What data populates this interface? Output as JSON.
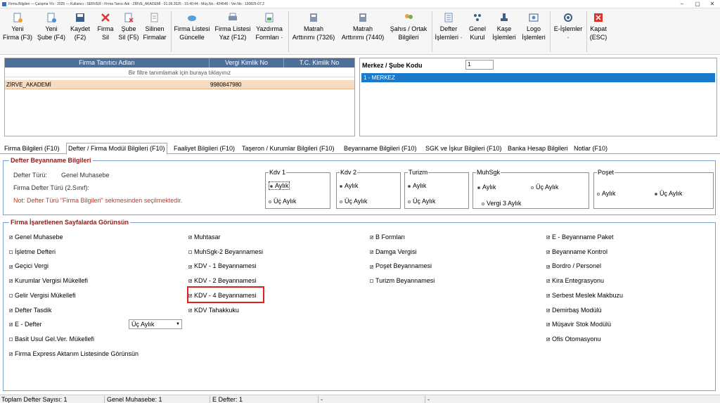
{
  "titlebar": {
    "text": "Firma Bilgileri — Çalışma Yılı : 2025 — Kullanıcı : SERVER - Firma Tanıcı Adı : ZİRVE_AKADEMİ - 01.09.2025 - 15:40:44 - Müş.No : 424646 - Ver.No : 130825-07.2"
  },
  "toolbar": [
    {
      "l1": "Yeni",
      "l2": "Firma (F3)",
      "icon": "new-company-icon"
    },
    {
      "l1": "Yeni",
      "l2": "Şube (F4)",
      "icon": "new-branch-icon"
    },
    {
      "l1": "Kaydet",
      "l2": "(F2)",
      "icon": "save-icon"
    },
    {
      "l1": "Firma",
      "l2": "Sil",
      "icon": "delete-icon"
    },
    {
      "l1": "Şube",
      "l2": "Sil (F5)",
      "icon": "delete-branch-icon"
    },
    {
      "l1": "Silinen",
      "l2": "Firmalar",
      "icon": "deleted-companies-icon"
    },
    {
      "l1": "Firma Listesi",
      "l2": "Güncelle",
      "icon": "refresh-list-icon"
    },
    {
      "l1": "Firma Listesi",
      "l2": "Yaz (F12)",
      "icon": "print-list-icon"
    },
    {
      "l1": "Yazdırma",
      "l2": "Formları ·",
      "icon": "print-forms-icon"
    },
    {
      "l1": "Matrah",
      "l2": "Arttırımı (7326)",
      "icon": "tax-base-icon"
    },
    {
      "l1": "Matrah",
      "l2": "Arttırımı (7440)",
      "icon": "tax-base-icon-2"
    },
    {
      "l1": "Şahıs / Ortak",
      "l2": "Bilgileri",
      "icon": "partners-icon"
    },
    {
      "l1": "Defter",
      "l2": "İşlemleri ·",
      "icon": "ledger-icon"
    },
    {
      "l1": "Genel",
      "l2": "Kurul",
      "icon": "general-assembly-icon"
    },
    {
      "l1": "Kaşe",
      "l2": "İşlemleri",
      "icon": "stamp-icon"
    },
    {
      "l1": "Logo",
      "l2": "İşlemleri",
      "icon": "logo-icon"
    },
    {
      "l1": "E-İşlemler",
      "l2": "·",
      "icon": "e-operations-icon"
    },
    {
      "l1": "Kapat",
      "l2": "(ESC)",
      "icon": "close-icon"
    }
  ],
  "grid": {
    "headers": [
      "Firma Tanıtıcı Adları",
      "Vergi Kimlik No",
      "T.C. Kimlik No"
    ],
    "filter": "Bir filtre tanımlamak için buraya tıklayınız",
    "rows": [
      {
        "name": "ZİRVE_AKADEMİ",
        "vkn": "9980847980",
        "tckn": ""
      }
    ]
  },
  "merkez": {
    "label": "Merkez / Şube Kodu",
    "value": "1",
    "selected": "1 - MERKEZ"
  },
  "tabs": [
    "Firma Bilgileri (F10)",
    "Defter / Firma Modül Bilgileri (F10)",
    "Faaliyet Bilgileri (F10)",
    "Taşeron / Kurumlar Bilgileri (F10)",
    "Beyanname Bilgileri (F10)",
    "SGK ve İşkur Bilgileri (F10)",
    "Banka Hesap Bilgileri",
    "Notlar (F10)"
  ],
  "defter": {
    "title": "Defter Beyanname Bilgileri",
    "turu_label": "Defter Türü:",
    "turu_value": "Genel Muhasebe",
    "firma_turu_label": "Firma Defter Türü (2.Sınıf):",
    "note": "Not: Defter Türü \"Firma Bilgileri\" sekmesinden seçilmektedir.",
    "groups": {
      "kdv1": {
        "title": "Kdv 1",
        "opt1": "Aylık",
        "opt2": "Üç Aylık"
      },
      "kdv2": {
        "title": "Kdv 2",
        "opt1": "Aylık",
        "opt2": "Üç Aylık"
      },
      "turizm": {
        "title": "Turizm",
        "opt1": "Aylık",
        "opt2": "Üç Aylık"
      },
      "muhsgk": {
        "title": "MuhSgk",
        "opt1": "Aylık",
        "opt2": "Üç Aylık",
        "opt3": "Vergi 3 Aylık"
      },
      "poset": {
        "title": "Poşet",
        "opt1": "Aylık",
        "opt2": "Üç Aylık"
      }
    }
  },
  "firma": {
    "title": "Firma İşaretlenen Sayfalarda Görünsün",
    "col1": [
      {
        "label": "Genel Muhasebe",
        "checked": true
      },
      {
        "label": "İşletme Defteri",
        "checked": false
      },
      {
        "label": "Geçici Vergi",
        "checked": true
      },
      {
        "label": "Kurumlar Vergisi Mükellefi",
        "checked": true
      },
      {
        "label": "Gelir Vergisi Mükellefi",
        "checked": false
      },
      {
        "label": "Defter Tasdik",
        "checked": true
      },
      {
        "label": "E - Defter",
        "checked": true
      },
      {
        "label": "Basit Usul Gel.Ver. Mükellefi",
        "checked": false
      },
      {
        "label": "Firma Express Aktarım Listesinde Görünsün",
        "checked": true
      }
    ],
    "edefter_select": "Üç Aylık",
    "col2": [
      {
        "label": "Muhtasar",
        "checked": true
      },
      {
        "label": "MuhSgk-2 Beyannamesi",
        "checked": false
      },
      {
        "label": "KDV - 1 Beyannamesi",
        "checked": true
      },
      {
        "label": "KDV - 2 Beyannamesi",
        "checked": true
      },
      {
        "label": "KDV - 4 Beyannamesi",
        "checked": true
      },
      {
        "label": "KDV Tahakkuku",
        "checked": true
      }
    ],
    "col3": [
      {
        "label": "B Formları",
        "checked": true
      },
      {
        "label": "Damga Vergisi",
        "checked": true
      },
      {
        "label": "Poşet Beyannamesi",
        "checked": true
      },
      {
        "label": "Turizm Beyannamesi",
        "checked": false
      }
    ],
    "col4": [
      {
        "label": "E - Beyanname Paket",
        "checked": true
      },
      {
        "label": "Beyanname Kontrol",
        "checked": true
      },
      {
        "label": "Bordro / Personel",
        "checked": true
      },
      {
        "label": "Kira Entegrasyonu",
        "checked": true
      },
      {
        "label": "Serbest Meslek Makbuzu",
        "checked": true
      },
      {
        "label": "Demirbaş Modülü",
        "checked": true
      },
      {
        "label": "Müşavir Stok Modülü",
        "checked": true
      },
      {
        "label": "Ofis Otomasyonu",
        "checked": true
      }
    ]
  },
  "status": {
    "total": "Toplam Defter Sayısı: 1",
    "genel": "Genel Muhasebe: 1",
    "edefter": "E Defter: 1",
    "dash1": "-",
    "dash2": "-"
  },
  "colors": {
    "header": "#4e6f99",
    "selection": "#1979ca",
    "row": "#f7dcc1",
    "highlight": "#e02020",
    "sectionTitle": "#8b1b1b"
  }
}
